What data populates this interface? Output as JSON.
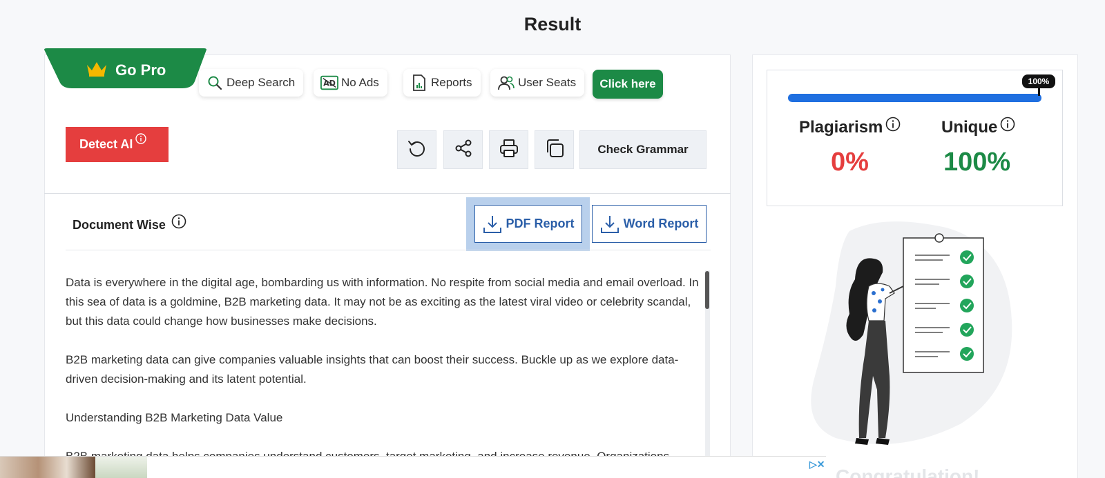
{
  "page": {
    "title": "Result"
  },
  "upsell": {
    "go_pro": "Go Pro",
    "features": [
      {
        "label": "Deep Search",
        "icon": "search-icon"
      },
      {
        "label": "No Ads",
        "icon": "no-ads-icon"
      },
      {
        "label": "Reports",
        "icon": "report-file-icon"
      },
      {
        "label": "User Seats",
        "icon": "users-icon"
      }
    ],
    "cta": "Click here"
  },
  "toolbar": {
    "detect_ai": "Detect AI",
    "tools": [
      "reload-icon",
      "share-icon",
      "print-icon",
      "copy-icon"
    ],
    "check_grammar": "Check Grammar"
  },
  "document": {
    "section_label": "Document Wise",
    "pdf_report": "PDF Report",
    "word_report": "Word Report",
    "paragraphs": [
      "Data is everywhere in the digital age, bombarding us with information. No respite from social media and email overload. In this sea of data is a goldmine, B2B marketing data. It may not be as exciting as the latest viral video or celebrity scandal, but this data could change how businesses make decisions.",
      "B2B marketing data can give companies valuable insights that can boost their success. Buckle up as we explore data-driven decision-making and its latent potential.",
      "Understanding B2B Marketing Data Value",
      "B2B marketing data helps companies understand customers, target marketing, and increase revenue. Organizations"
    ]
  },
  "result": {
    "progress_label": "100%",
    "progress_fraction": 1.0,
    "plagiarism_label": "Plagiarism",
    "plagiarism_value": "0%",
    "unique_label": "Unique",
    "unique_value": "100%",
    "congrats_text": "Congratulation!"
  },
  "colors": {
    "brand_green": "#1c8a46",
    "danger_red": "#e53e3e",
    "accent_blue": "#2a5ea8",
    "progress_blue": "#1f6fe0"
  }
}
